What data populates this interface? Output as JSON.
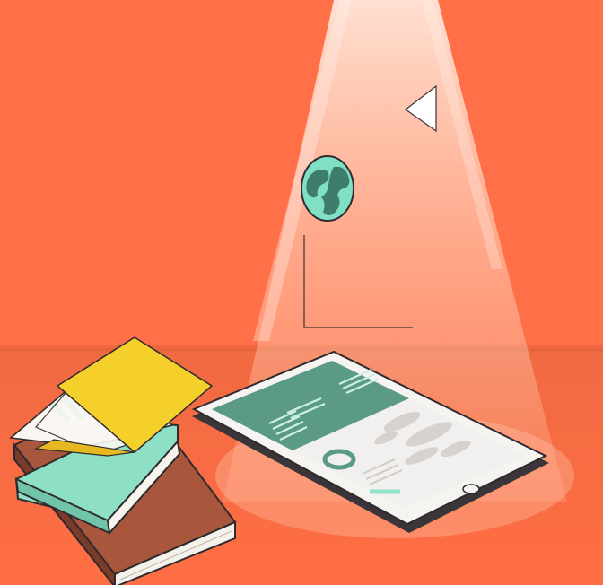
{
  "scene": {
    "description_free": true,
    "colors": {
      "background": "#FF6E45",
      "background_top": "#FF7349",
      "horizon": "#E8653F",
      "spotlight": "#FFD9C6",
      "ink": "#2E2A2E",
      "teal": "#5A9A86",
      "mint": "#8FE3CC",
      "yellow": "#F5CF2A",
      "book_brown": "#A8563C",
      "book_mint": "#8DE0C6",
      "paper": "#FAF7F2",
      "tablet_body": "#F6F4F1",
      "tablet_shadow": "#3A3538",
      "map_grey": "#D9D6D3"
    },
    "icons": [
      "globe-icon",
      "play-triangle-icon",
      "corner-bracket-icon",
      "home-button-icon",
      "donut-chart-icon"
    ]
  }
}
